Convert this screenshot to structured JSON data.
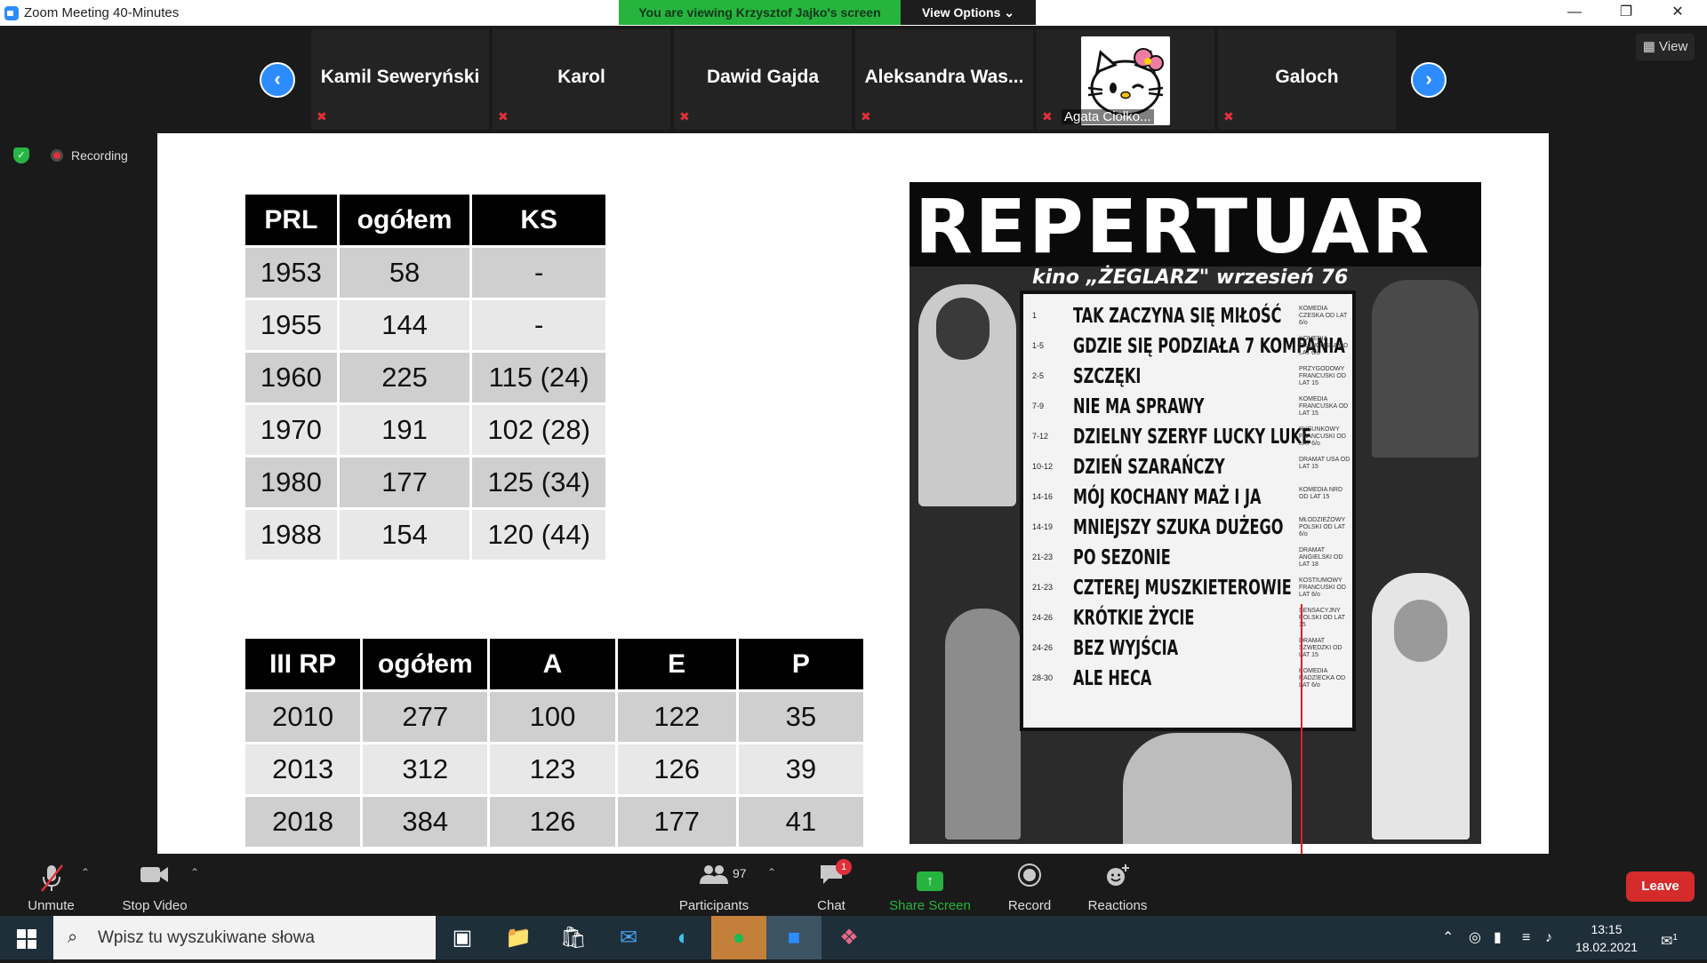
{
  "window": {
    "title": "Zoom Meeting 40-Minutes",
    "viewing_banner": "You are viewing Krzysztof Jajko's screen",
    "view_options": "View Options ⌄",
    "minimize": "—",
    "restore": "❐",
    "close": "✕"
  },
  "participants": [
    {
      "name": "Kamil Seweryński"
    },
    {
      "name": "Karol"
    },
    {
      "name": "Dawid Gajda"
    },
    {
      "name": "Aleksandra  Was..."
    },
    {
      "name": "",
      "label": "Agata Ciołko..."
    },
    {
      "name": "Galoch"
    }
  ],
  "nav": {
    "prev": "‹",
    "next": "›"
  },
  "view_button": "▦ View",
  "status": {
    "recording": "Recording",
    "shield": "✓"
  },
  "table_prl": {
    "headers": [
      "PRL",
      "ogółem",
      "KS"
    ],
    "rows": [
      [
        "1953",
        "58",
        "-"
      ],
      [
        "1955",
        "144",
        "-"
      ],
      [
        "1960",
        "225",
        "115 (24)"
      ],
      [
        "1970",
        "191",
        "102 (28)"
      ],
      [
        "1980",
        "177",
        "125 (34)"
      ],
      [
        "1988",
        "154",
        "120 (44)"
      ]
    ]
  },
  "table_rp": {
    "headers": [
      "III RP",
      "ogółem",
      "A",
      "E",
      "P"
    ],
    "rows": [
      [
        "2010",
        "277",
        "100",
        "122",
        "35"
      ],
      [
        "2013",
        "312",
        "123",
        "126",
        "39"
      ],
      [
        "2018",
        "384",
        "126",
        "177",
        "41"
      ]
    ]
  },
  "poster": {
    "title": "REPERTUAR",
    "subtitle": "kino „ŻEGLARZ\" wrzesień 76",
    "films": [
      {
        "date": "1",
        "title": "TAK ZACZYNA SIĘ MIŁOŚĆ",
        "genre": "KOMEDIA CZESKA OD LAT 6/o"
      },
      {
        "date": "1-5",
        "title": "GDZIE SIĘ PODZIAŁA 7 KOMPANIA",
        "genre": "KOMEDIA FRANCUSKA OD LAT 6/o"
      },
      {
        "date": "2-5",
        "title": "SZCZĘKI",
        "genre": "PRZYGODOWY FRANCUSKI OD LAT 15"
      },
      {
        "date": "7-9",
        "title": "NIE MA SPRAWY",
        "genre": "KOMEDIA FRANCUSKA OD LAT 15"
      },
      {
        "date": "7-12",
        "title": "DZIELNY SZERYF LUCKY LUKE",
        "genre": "RYSUNKOWY FRANCUSKI OD LAT 6/o"
      },
      {
        "date": "10-12",
        "title": "DZIEŃ SZARAŃCZY",
        "genre": "DRAMAT USA OD LAT 15"
      },
      {
        "date": "14-16",
        "title": "MÓJ KOCHANY MAŻ I JA",
        "genre": "KOMEDIA NRD OD LAT 15"
      },
      {
        "date": "14-19",
        "title": "MNIEJSZY SZUKA DUŻEGO",
        "genre": "MŁODZIEŻOWY POLSKI OD LAT 6/o"
      },
      {
        "date": "21-23",
        "title": "PO SEZONIE",
        "genre": "DRAMAT ANGIELSKI OD LAT 18"
      },
      {
        "date": "21-23",
        "title": "CZTEREJ MUSZKIETEROWIE",
        "genre": "KOSTIUMOWY FRANCUSKI OD LAT 6/o"
      },
      {
        "date": "24-26",
        "title": "KRÓTKIE ŻYCIE",
        "genre": "SENSACYJNY POLSKI OD LAT 15"
      },
      {
        "date": "24-26",
        "title": "BEZ WYJŚCIA",
        "genre": "DRAMAT SZWEDZKI OD LAT 15"
      },
      {
        "date": "28-30",
        "title": "ALE HECA",
        "genre": "KOMEDIA RADZIECKA OD LAT 6/o"
      }
    ]
  },
  "toolbar": {
    "unmute": "Unmute",
    "stop_video": "Stop Video",
    "participants_count": "97",
    "participants": "Participants",
    "chat": "Chat",
    "chat_badge": "1",
    "share_screen": "Share Screen",
    "record": "Record",
    "reactions": "Reactions",
    "leave": "Leave"
  },
  "taskbar": {
    "search_placeholder": "Wpisz tu wyszukiwane słowa",
    "time": "13:15",
    "date": "18.02.2021",
    "notifications": "1"
  }
}
